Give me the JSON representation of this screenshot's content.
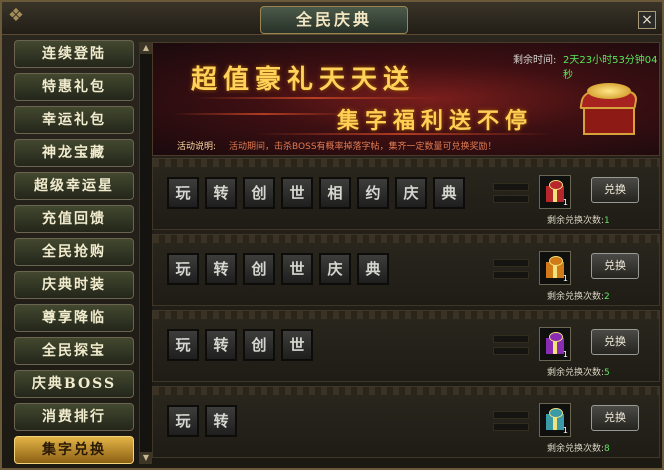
{
  "window": {
    "title": "全民庆典",
    "close_icon": "×"
  },
  "sidebar": {
    "items": [
      {
        "label": "连续登陆"
      },
      {
        "label": "特惠礼包"
      },
      {
        "label": "幸运礼包"
      },
      {
        "label": "神龙宝藏"
      },
      {
        "label": "超级幸运星"
      },
      {
        "label": "充值回馈"
      },
      {
        "label": "全民抢购"
      },
      {
        "label": "庆典时装"
      },
      {
        "label": "尊享降临"
      },
      {
        "label": "全民探宝"
      },
      {
        "label": "庆典BOSS"
      },
      {
        "label": "消费排行"
      },
      {
        "label": "集字兑换"
      }
    ],
    "active_index": 12
  },
  "banner": {
    "title1": "超值豪礼天天送",
    "title2": "集字福利送不停",
    "time_label": "剩余时间:",
    "time_value": "2天23小时53分钟04秒",
    "desc_label": "活动说明:",
    "desc_text": "活动期间，击杀BOSS有概率掉落字帖，集齐一定数量可兑换奖励！"
  },
  "exchange_rows": [
    {
      "chars": [
        "玩",
        "转",
        "创",
        "世",
        "相",
        "约",
        "庆",
        "典"
      ],
      "button": "兑换",
      "remain_label": "剩余兑换次数:",
      "remain": "1",
      "gift_qty": "1",
      "gift_color": "#b7262a"
    },
    {
      "chars": [
        "玩",
        "转",
        "创",
        "世",
        "庆",
        "典"
      ],
      "button": "兑换",
      "remain_label": "剩余兑换次数:",
      "remain": "2",
      "gift_qty": "1",
      "gift_color": "#d07a18"
    },
    {
      "chars": [
        "玩",
        "转",
        "创",
        "世"
      ],
      "button": "兑换",
      "remain_label": "剩余兑换次数:",
      "remain": "5",
      "gift_qty": "1",
      "gift_color": "#8a2cb3"
    },
    {
      "chars": [
        "玩",
        "转"
      ],
      "button": "兑换",
      "remain_label": "剩余兑换次数:",
      "remain": "8",
      "gift_qty": "1",
      "gift_color": "#3a9aa6"
    }
  ],
  "colors": {
    "accent_gold": "#ffd35a",
    "remain_green": "#5ee35f",
    "active_tab": "#e3b445"
  }
}
